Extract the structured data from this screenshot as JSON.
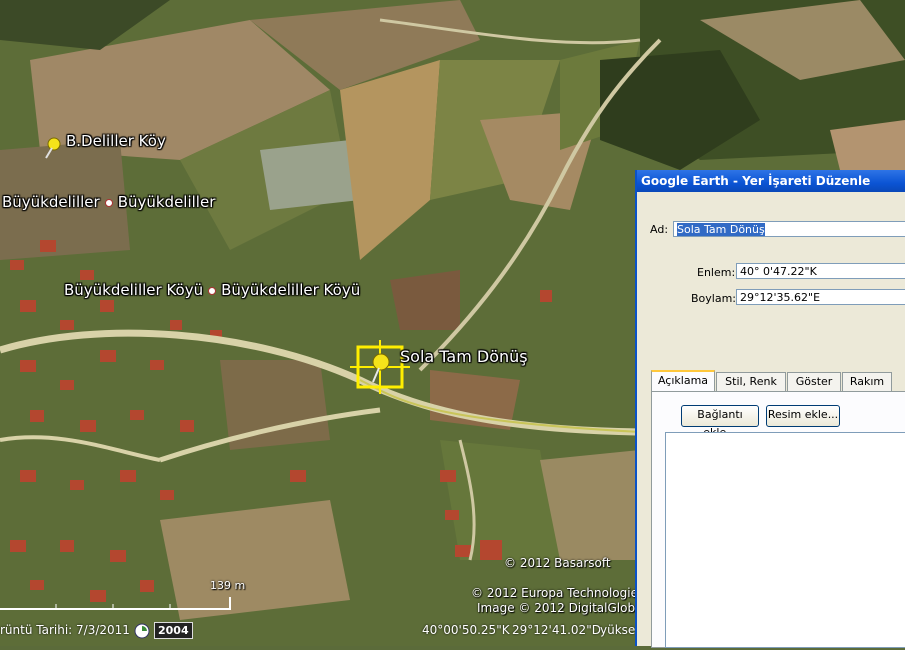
{
  "map": {
    "labels": {
      "b_deliller": "B.Deliller Köy",
      "buyukdeliller_left": "Büyükdeliller",
      "buyukdeliller_right": "Büyükdeliller",
      "koyu_left": "Büyükdeliller Köyü",
      "koyu_right": "Büyükdeliller Köyü",
      "placemark": "Sola Tam Dönüş"
    },
    "copyrights": {
      "basarsoft": "© 2012 Basarsoft",
      "europa": "© 2012 Europa Technologies",
      "digitalglobe": "Image © 2012 DigitalGlobe"
    },
    "scale_label": "139 m",
    "status": {
      "imagery_date": "rüntü Tarihi: 7/3/2011",
      "year": "2004",
      "lat": "40°00'50.25\"K",
      "lon": "29°12'41.02\"D",
      "elev": "yükse"
    },
    "colors": {
      "placemark_highlight": "#ffee00",
      "road": "#d8d2a8"
    }
  },
  "dialog": {
    "title": "Google Earth - Yer İşareti Düzenle",
    "name_label": "Ad:",
    "name_value": "Sola Tam Dönüş",
    "lat_label": "Enlem:",
    "lat_value": "40° 0'47.22\"K",
    "lon_label": "Boylam:",
    "lon_value": "29°12'35.62\"E",
    "tabs": [
      "Açıklama",
      "Stil, Renk",
      "Göster",
      "Rakım"
    ],
    "add_link_button": "Bağlantı ekle...",
    "add_image_button": "Resim ekle..."
  }
}
